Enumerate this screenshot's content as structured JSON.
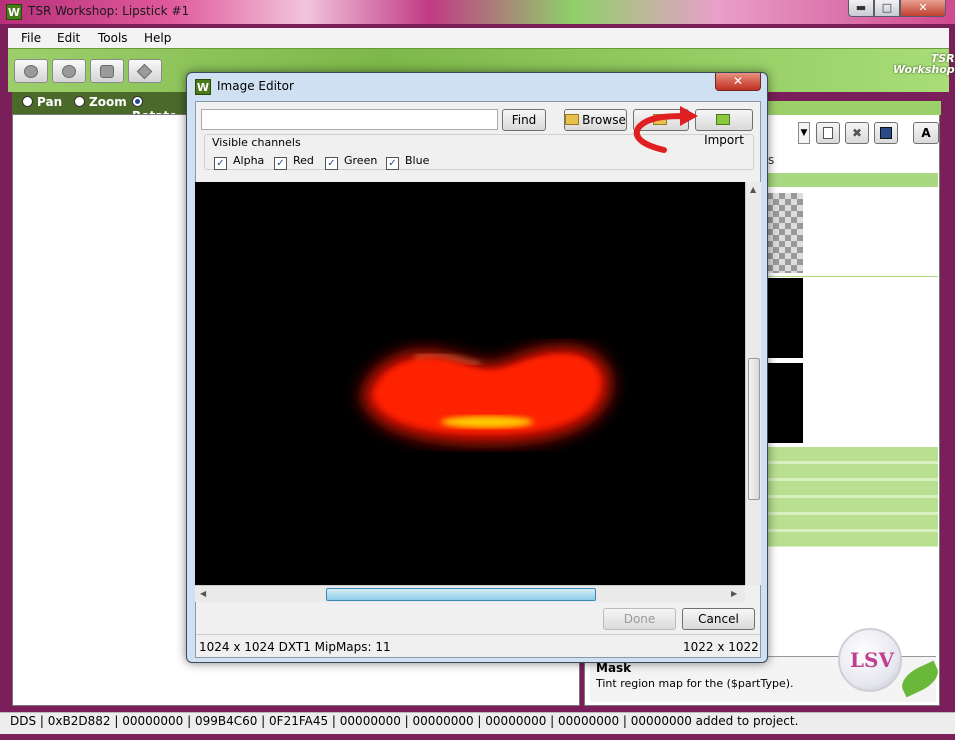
{
  "window": {
    "title": "TSR Workshop: Lipstick #1",
    "icon_letter": "W",
    "minimize_glyph": "▬",
    "maximize_glyph": "□",
    "close_glyph": "✕"
  },
  "menu": [
    "File",
    "Edit",
    "Tools",
    "Help"
  ],
  "brand": {
    "line1": "TSR",
    "line2": "Workshop"
  },
  "modes": [
    {
      "label": "Pan",
      "selected": false
    },
    {
      "label": "Zoom",
      "selected": false
    },
    {
      "label": "Rotate",
      "selected": true
    }
  ],
  "right_panel": {
    "letter_button": "A",
    "tab_fragment": "s",
    "mask_title": "Mask",
    "mask_desc": "Tint region map for the ($partType)."
  },
  "dialog": {
    "title": "Image Editor",
    "icon_letter": "W",
    "close_glyph": "✕",
    "search_value": "",
    "find_label": "Find",
    "browse_label": "Browse",
    "import_label": "Import",
    "channels_title": "Visible channels",
    "channels": [
      {
        "label": "Alpha",
        "checked": true
      },
      {
        "label": "Red",
        "checked": true
      },
      {
        "label": "Green",
        "checked": true
      },
      {
        "label": "Blue",
        "checked": true
      }
    ],
    "done_label": "Done",
    "cancel_label": "Cancel",
    "status_left": "1024 x 1024 DXT1 MipMaps: 11",
    "status_right": "1022 x 1022"
  },
  "statusbar": {
    "text": "DDS | 0xB2D882 | 00000000 | 099B4C60 | 0F21FA45 | 00000000 | 00000000 | 00000000 | 00000000 | 00000000 added to project."
  },
  "watermark": {
    "text": "LSV"
  },
  "colors": {
    "accent_green": "#7db84a",
    "arrow_red": "#e02020",
    "lip_red": "#ff1a00"
  }
}
